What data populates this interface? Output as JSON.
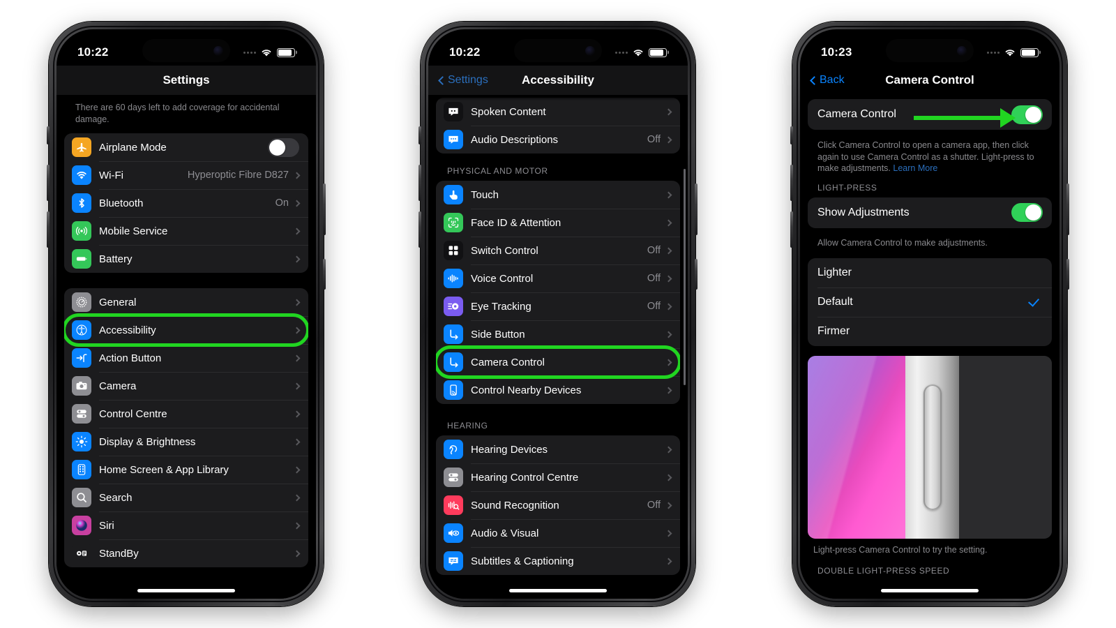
{
  "colors": {
    "highlight_green": "#21d521",
    "toggle_on_green": "#30d158",
    "accent_blue": "#0a84ff",
    "page_background": "#ffffff",
    "screen_background": "#000000"
  },
  "phone1": {
    "status": {
      "time": "10:22",
      "wifi_icon": "wifi-icon",
      "battery_icon": "battery-icon",
      "cellular_icon": "cellular-dots-icon"
    },
    "nav": {
      "title": "Settings"
    },
    "coverage_note": "There are 60 days left to add coverage for accidental damage.",
    "group_a": [
      {
        "label": "Airplane Mode",
        "icon": "airplane-icon",
        "icon_color": "#f5a623",
        "control": "toggle",
        "toggle_on": false
      },
      {
        "label": "Wi-Fi",
        "icon": "wifi-icon",
        "icon_color": "#0a84ff",
        "value": "Hyperoptic Fibre D827",
        "control": "chevron"
      },
      {
        "label": "Bluetooth",
        "icon": "bluetooth-icon",
        "icon_color": "#0a84ff",
        "value": "On",
        "control": "chevron"
      },
      {
        "label": "Mobile Service",
        "icon": "antenna-icon",
        "icon_color": "#34c759",
        "value": "",
        "control": "chevron"
      },
      {
        "label": "Battery",
        "icon": "battery-icon",
        "icon_color": "#34c759",
        "value": "",
        "control": "chevron"
      }
    ],
    "group_b": [
      {
        "label": "General",
        "icon": "gear-icon",
        "icon_color": "#8e8e93",
        "value": "",
        "control": "chevron",
        "highlighted": false
      },
      {
        "label": "Accessibility",
        "icon": "accessibility-icon",
        "icon_color": "#0a84ff",
        "value": "",
        "control": "chevron",
        "highlighted": true
      },
      {
        "label": "Action Button",
        "icon": "action-button-icon",
        "icon_color": "#0a84ff",
        "value": "",
        "control": "chevron",
        "highlighted": false
      },
      {
        "label": "Camera",
        "icon": "camera-icon",
        "icon_color": "#8e8e93",
        "value": "",
        "control": "chevron",
        "highlighted": false
      },
      {
        "label": "Control Centre",
        "icon": "control-centre-icon",
        "icon_color": "#8e8e93",
        "value": "",
        "control": "chevron",
        "highlighted": false
      },
      {
        "label": "Display & Brightness",
        "icon": "brightness-icon",
        "icon_color": "#0a84ff",
        "value": "",
        "control": "chevron",
        "highlighted": false
      },
      {
        "label": "Home Screen & App Library",
        "icon": "home-screen-icon",
        "icon_color": "#0a84ff",
        "value": "",
        "control": "chevron",
        "highlighted": false
      },
      {
        "label": "Search",
        "icon": "search-icon",
        "icon_color": "#8e8e93",
        "value": "",
        "control": "chevron",
        "highlighted": false
      },
      {
        "label": "Siri",
        "icon": "siri-icon",
        "icon_color": "#c840a0",
        "value": "",
        "control": "chevron",
        "highlighted": false
      },
      {
        "label": "StandBy",
        "icon": "standby-icon",
        "icon_color": "#1c1c1e",
        "value": "",
        "control": "chevron",
        "highlighted": false
      }
    ]
  },
  "phone2": {
    "status": {
      "time": "10:22",
      "wifi_icon": "wifi-icon",
      "battery_icon": "battery-icon",
      "cellular_icon": "cellular-dots-icon"
    },
    "nav": {
      "back_label": "Settings",
      "title": "Accessibility"
    },
    "group_top": [
      {
        "label": "Spoken Content",
        "icon": "spoken-content-icon",
        "icon_color": "#111113",
        "value": "",
        "control": "chevron"
      },
      {
        "label": "Audio Descriptions",
        "icon": "audio-descriptions-icon",
        "icon_color": "#0a84ff",
        "value": "Off",
        "control": "chevron"
      }
    ],
    "section_physical": "PHYSICAL AND MOTOR",
    "group_physical": [
      {
        "label": "Touch",
        "icon": "touch-icon",
        "icon_color": "#0a84ff",
        "value": "",
        "control": "chevron",
        "highlighted": false
      },
      {
        "label": "Face ID & Attention",
        "icon": "face-id-icon",
        "icon_color": "#34c759",
        "value": "",
        "control": "chevron",
        "highlighted": false
      },
      {
        "label": "Switch Control",
        "icon": "switch-control-icon",
        "icon_color": "#111113",
        "value": "Off",
        "control": "chevron",
        "highlighted": false
      },
      {
        "label": "Voice Control",
        "icon": "voice-control-icon",
        "icon_color": "#0a84ff",
        "value": "Off",
        "control": "chevron",
        "highlighted": false
      },
      {
        "label": "Eye Tracking",
        "icon": "eye-tracking-icon",
        "icon_color": "#7b5cf0",
        "value": "Off",
        "control": "chevron",
        "highlighted": false
      },
      {
        "label": "Side Button",
        "icon": "side-button-icon",
        "icon_color": "#0a84ff",
        "value": "",
        "control": "chevron",
        "highlighted": false
      },
      {
        "label": "Camera Control",
        "icon": "camera-control-icon",
        "icon_color": "#0a84ff",
        "value": "",
        "control": "chevron",
        "highlighted": true
      },
      {
        "label": "Control Nearby Devices",
        "icon": "control-nearby-devices-icon",
        "icon_color": "#0a84ff",
        "value": "",
        "control": "chevron",
        "highlighted": false
      }
    ],
    "section_hearing": "HEARING",
    "group_hearing": [
      {
        "label": "Hearing Devices",
        "icon": "hearing-devices-icon",
        "icon_color": "#0a84ff",
        "value": "",
        "control": "chevron"
      },
      {
        "label": "Hearing Control Centre",
        "icon": "hearing-control-centre-icon",
        "icon_color": "#8e8e93",
        "value": "",
        "control": "chevron"
      },
      {
        "label": "Sound Recognition",
        "icon": "sound-recognition-icon",
        "icon_color": "#ff3b5c",
        "value": "Off",
        "control": "chevron"
      },
      {
        "label": "Audio & Visual",
        "icon": "audio-visual-icon",
        "icon_color": "#0a84ff",
        "value": "",
        "control": "chevron"
      },
      {
        "label": "Subtitles & Captioning",
        "icon": "subtitles-icon",
        "icon_color": "#0a84ff",
        "value": "",
        "control": "chevron"
      }
    ]
  },
  "phone3": {
    "status": {
      "time": "10:23",
      "wifi_icon": "wifi-icon",
      "battery_icon": "battery-icon",
      "cellular_icon": "cellular-dots-icon"
    },
    "nav": {
      "back_label": "Back",
      "title": "Camera Control"
    },
    "main_toggle": {
      "label": "Camera Control",
      "toggle_on": true,
      "highlighted": true
    },
    "main_note": "Click Camera Control to open a camera app, then click again to use Camera Control as a shutter. Light-press to make adjustments. ",
    "main_note_link": "Learn More",
    "section_light_press": "LIGHT-PRESS",
    "show_adjustments": {
      "label": "Show Adjustments",
      "toggle_on": true
    },
    "show_adjustments_note": "Allow Camera Control to make adjustments.",
    "pressure_options": [
      {
        "label": "Lighter",
        "selected": false
      },
      {
        "label": "Default",
        "selected": true
      },
      {
        "label": "Firmer",
        "selected": false
      }
    ],
    "preview_caption": "Light-press Camera Control to try the setting.",
    "section_double_press": "DOUBLE LIGHT-PRESS SPEED"
  }
}
